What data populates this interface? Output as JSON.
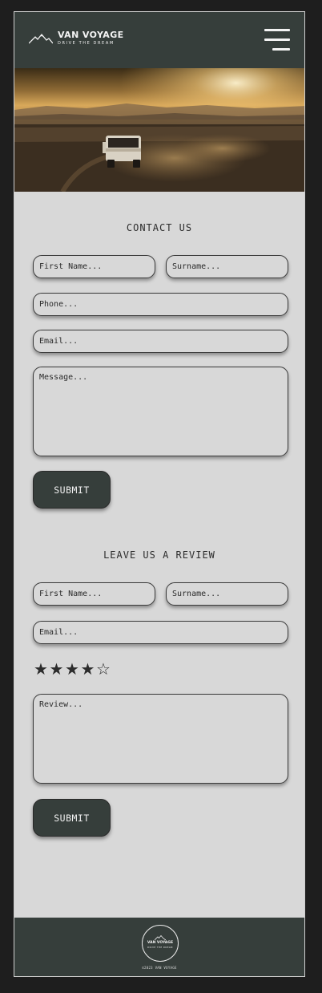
{
  "brand": {
    "name": "VAN VOYAGE",
    "tagline": "DRIVE THE DREAM"
  },
  "contact": {
    "title": "CONTACT US",
    "first_name_placeholder": "First Name...",
    "surname_placeholder": "Surname...",
    "phone_placeholder": "Phone...",
    "email_placeholder": "Email...",
    "message_placeholder": "Message...",
    "submit_label": "SUBMIT"
  },
  "review": {
    "title": "LEAVE US A REVIEW",
    "first_name_placeholder": "First Name...",
    "surname_placeholder": "Surname...",
    "email_placeholder": "Email...",
    "rating": 4,
    "rating_max": 5,
    "stars": [
      "★",
      "★",
      "★",
      "★",
      "☆"
    ],
    "review_placeholder": "Review...",
    "submit_label": "SUBMIT"
  },
  "footer": {
    "badge_name": "VAN VOYAGE",
    "badge_tagline": "DRIVE THE DREAM",
    "copyright": "©2023 VAN VOYAGE"
  },
  "colors": {
    "header": "#363e3b",
    "page": "#d8d8d8",
    "frame_bg": "#1e1e1e",
    "text": "#2c2c2c"
  },
  "icons": {
    "menu": "hamburger-icon",
    "logo": "mountain-icon"
  }
}
